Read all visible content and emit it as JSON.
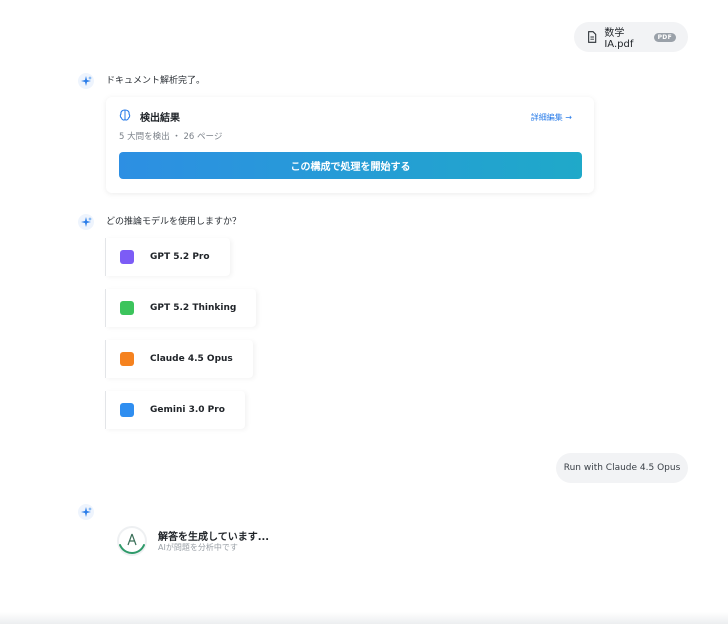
{
  "user_file": {
    "name": "数学IA.pdf",
    "badge": "PDF",
    "icon": "file-icon"
  },
  "ai_message_1": {
    "text": "ドキュメント解析完了。",
    "avatar_icon": "sparkle-icon"
  },
  "detection_card": {
    "icon": "brain-icon",
    "title": "検出結果",
    "detail_link": "詳細編集 →",
    "meta": "5 大問を検出 ・ 26 ページ",
    "start_button": "この構成で処理を開始する"
  },
  "ai_message_2": {
    "text": "どの推論モデルを使用しますか？",
    "avatar_icon": "sparkle-icon"
  },
  "models": [
    {
      "label": "GPT 5.2 Pro",
      "color": "#7c5cf6"
    },
    {
      "label": "GPT 5.2 Thinking",
      "color": "#3cc45c"
    },
    {
      "label": "Claude 4.5 Opus",
      "color": "#f5821f"
    },
    {
      "label": "Gemini 3.0 Pro",
      "color": "#2f8ef0"
    }
  ],
  "user_run": {
    "text": "Run with Claude 4.5 Opus"
  },
  "generating": {
    "title": "解答を生成しています...",
    "subtitle": "AIが問題を分析中です",
    "icon": "claude-spinner-icon"
  }
}
